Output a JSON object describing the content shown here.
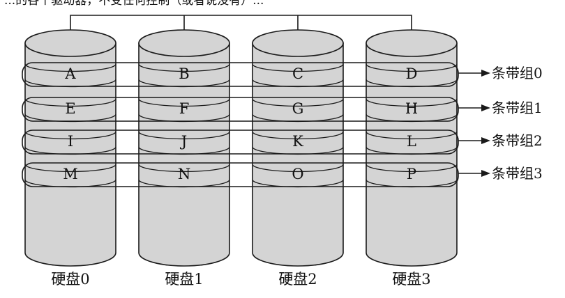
{
  "top_text": "...的各个驱动器，不受任何控制（或者说没有）...",
  "disks": [
    {
      "label": "硬盘0",
      "cells": [
        "A",
        "E",
        "I",
        "M"
      ]
    },
    {
      "label": "硬盘1",
      "cells": [
        "B",
        "F",
        "J",
        "N"
      ]
    },
    {
      "label": "硬盘2",
      "cells": [
        "C",
        "G",
        "K",
        "O"
      ]
    },
    {
      "label": "硬盘3",
      "cells": [
        "D",
        "H",
        "L",
        "P"
      ]
    }
  ],
  "stripe_groups": [
    {
      "label": "条带组0"
    },
    {
      "label": "条带组1"
    },
    {
      "label": "条带组2"
    },
    {
      "label": "条带组3"
    }
  ],
  "colors": {
    "cylinder_fill": "#d4d4d4",
    "line": "#1a1a1a",
    "background": "#ffffff"
  }
}
